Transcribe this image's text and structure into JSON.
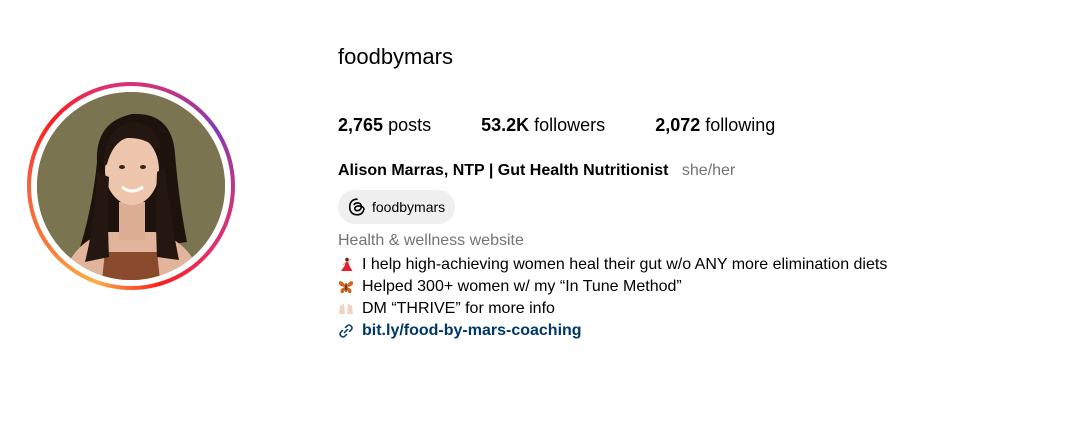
{
  "profile": {
    "username": "foodbymars",
    "stats": {
      "posts_count": "2,765",
      "posts_label": "posts",
      "followers_count": "53.2K",
      "followers_label": "followers",
      "following_count": "2,072",
      "following_label": "following"
    },
    "full_name": "Alison Marras, NTP | Gut Health Nutritionist",
    "pronouns": "she/her",
    "threads_handle": "foodbymars",
    "category": "Health & wellness website",
    "bio_lines": [
      {
        "icon": "dancer-icon",
        "text": "I help high-achieving women heal their gut w/o ANY more elimination diets"
      },
      {
        "icon": "butterfly-icon",
        "text": "Helped 300+ women w/ my “In Tune Method”"
      },
      {
        "icon": "raised-hands-icon",
        "text": "DM “THRIVE” for more info"
      }
    ],
    "link": "bit.ly/food-by-mars-coaching"
  },
  "colors": {
    "link": "#00376b",
    "muted": "#737373",
    "pill_bg": "#efefef"
  }
}
